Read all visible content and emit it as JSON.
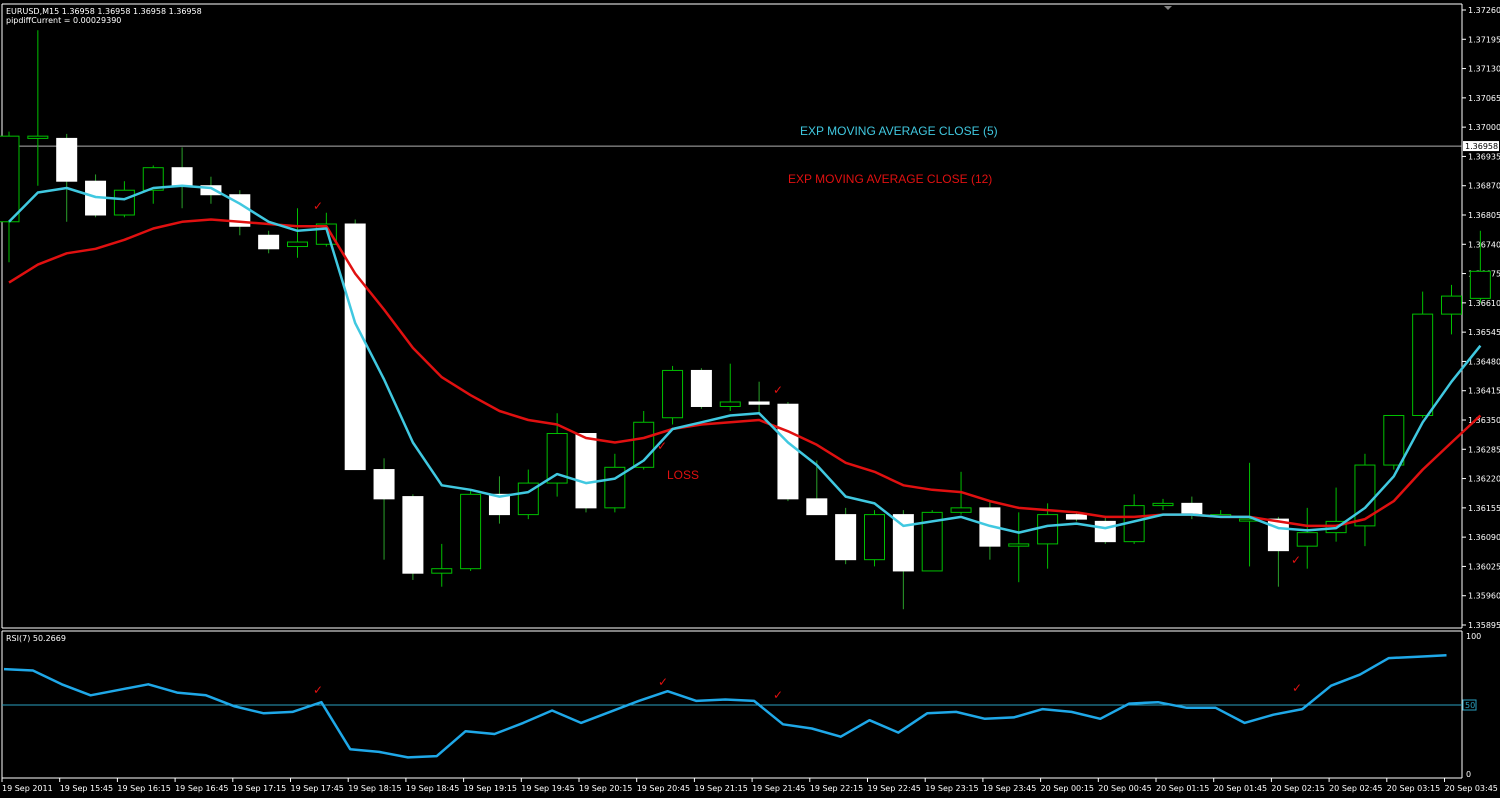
{
  "header": {
    "symbol_line": "EURUSD,M15  1.36958 1.36958 1.36958 1.36958",
    "indicator_line": "pipdiffCurrent = 0.00029390"
  },
  "annotations": {
    "ema5_label": "EXP MOVING AVERAGE CLOSE (5)",
    "ema12_label": "EXP MOVING AVERAGE CLOSE (12)",
    "loss_label": "LOSS",
    "checkmark": "✓"
  },
  "rsi_panel": {
    "title": "RSI(7) 50.2669",
    "level_label": "50",
    "tick_top": "100",
    "tick_bottom": "0"
  },
  "colors": {
    "background": "#000000",
    "grid": "#ffffff",
    "bull_candle": "#00c000",
    "bear_candle": "#ffffff",
    "ema5": "#40c8e0",
    "ema12": "#e01010",
    "annotation_red": "#e01010",
    "annotation_cyan": "#40c8e0",
    "rsi_line": "#1fa8e8",
    "rsi_level": "#2aa0c0"
  },
  "chart_data": {
    "type": "candlestick",
    "price_range": [
      1.35895,
      1.3726
    ],
    "current_price": 1.36958,
    "current_price_label": "1.36958",
    "price_ticks": [
      "1.37260",
      "1.37195",
      "1.37130",
      "1.37065",
      "1.37000",
      "1.36935",
      "1.36870",
      "1.36805",
      "1.36740",
      "1.36675",
      "1.36610",
      "1.36545",
      "1.36480",
      "1.36415",
      "1.36350",
      "1.36285",
      "1.36220",
      "1.36155",
      "1.36090",
      "1.36025",
      "1.35960",
      "1.35895"
    ],
    "time_ticks": [
      "19 Sep 2011",
      "19 Sep 15:45",
      "19 Sep 16:15",
      "19 Sep 16:45",
      "19 Sep 17:15",
      "19 Sep 17:45",
      "19 Sep 18:15",
      "19 Sep 18:45",
      "19 Sep 19:15",
      "19 Sep 19:45",
      "19 Sep 20:15",
      "19 Sep 20:45",
      "19 Sep 21:15",
      "19 Sep 21:45",
      "19 Sep 22:15",
      "19 Sep 22:45",
      "19 Sep 23:15",
      "19 Sep 23:45",
      "20 Sep 00:15",
      "20 Sep 00:45",
      "20 Sep 01:15",
      "20 Sep 01:45",
      "20 Sep 02:15",
      "20 Sep 02:45",
      "20 Sep 03:15",
      "20 Sep 03:45"
    ],
    "candles": [
      {
        "o": 1.3679,
        "h": 1.3699,
        "l": 1.367,
        "c": 1.3698
      },
      {
        "o": 1.36975,
        "h": 1.37215,
        "l": 1.3687,
        "c": 1.3698
      },
      {
        "o": 1.36975,
        "h": 1.36985,
        "l": 1.3679,
        "c": 1.3688
      },
      {
        "o": 1.3688,
        "h": 1.36895,
        "l": 1.368,
        "c": 1.36805
      },
      {
        "o": 1.36805,
        "h": 1.3688,
        "l": 1.368,
        "c": 1.3686
      },
      {
        "o": 1.3686,
        "h": 1.36915,
        "l": 1.3683,
        "c": 1.3691
      },
      {
        "o": 1.3691,
        "h": 1.36955,
        "l": 1.3682,
        "c": 1.3687
      },
      {
        "o": 1.3687,
        "h": 1.3689,
        "l": 1.3683,
        "c": 1.3685
      },
      {
        "o": 1.3685,
        "h": 1.3686,
        "l": 1.3676,
        "c": 1.3678
      },
      {
        "o": 1.3676,
        "h": 1.3677,
        "l": 1.3672,
        "c": 1.3673
      },
      {
        "o": 1.36735,
        "h": 1.3682,
        "l": 1.3671,
        "c": 1.36745
      },
      {
        "o": 1.3674,
        "h": 1.3681,
        "l": 1.36735,
        "c": 1.36785
      },
      {
        "o": 1.36785,
        "h": 1.36795,
        "l": 1.363,
        "c": 1.3624
      },
      {
        "o": 1.3624,
        "h": 1.36265,
        "l": 1.3604,
        "c": 1.36175
      },
      {
        "o": 1.3618,
        "h": 1.36185,
        "l": 1.35995,
        "c": 1.3601
      },
      {
        "o": 1.3601,
        "h": 1.36075,
        "l": 1.3598,
        "c": 1.3602
      },
      {
        "o": 1.3602,
        "h": 1.36195,
        "l": 1.36015,
        "c": 1.36185
      },
      {
        "o": 1.36185,
        "h": 1.36225,
        "l": 1.3612,
        "c": 1.3614
      },
      {
        "o": 1.3614,
        "h": 1.3624,
        "l": 1.3613,
        "c": 1.3621
      },
      {
        "o": 1.3621,
        "h": 1.36365,
        "l": 1.3618,
        "c": 1.3632
      },
      {
        "o": 1.3632,
        "h": 1.36315,
        "l": 1.36145,
        "c": 1.36155
      },
      {
        "o": 1.36155,
        "h": 1.36275,
        "l": 1.36145,
        "c": 1.36245
      },
      {
        "o": 1.36245,
        "h": 1.3637,
        "l": 1.3624,
        "c": 1.36345
      },
      {
        "o": 1.36355,
        "h": 1.3647,
        "l": 1.3634,
        "c": 1.3646
      },
      {
        "o": 1.3646,
        "h": 1.36465,
        "l": 1.36375,
        "c": 1.3638
      },
      {
        "o": 1.3638,
        "h": 1.36475,
        "l": 1.3637,
        "c": 1.3639
      },
      {
        "o": 1.3639,
        "h": 1.36435,
        "l": 1.36365,
        "c": 1.36385
      },
      {
        "o": 1.36385,
        "h": 1.3639,
        "l": 1.3617,
        "c": 1.36175
      },
      {
        "o": 1.36175,
        "h": 1.3626,
        "l": 1.3614,
        "c": 1.3614
      },
      {
        "o": 1.3614,
        "h": 1.36155,
        "l": 1.3603,
        "c": 1.3604
      },
      {
        "o": 1.3604,
        "h": 1.3615,
        "l": 1.36025,
        "c": 1.3614
      },
      {
        "o": 1.3614,
        "h": 1.3615,
        "l": 1.3593,
        "c": 1.36015
      },
      {
        "o": 1.36015,
        "h": 1.3615,
        "l": 1.36015,
        "c": 1.36145
      },
      {
        "o": 1.36145,
        "h": 1.36235,
        "l": 1.3614,
        "c": 1.36155
      },
      {
        "o": 1.36155,
        "h": 1.3617,
        "l": 1.3604,
        "c": 1.3607
      },
      {
        "o": 1.3607,
        "h": 1.36145,
        "l": 1.3599,
        "c": 1.36075
      },
      {
        "o": 1.36075,
        "h": 1.36165,
        "l": 1.3602,
        "c": 1.3614
      },
      {
        "o": 1.3614,
        "h": 1.36145,
        "l": 1.36125,
        "c": 1.3613
      },
      {
        "o": 1.36125,
        "h": 1.36135,
        "l": 1.36075,
        "c": 1.3608
      },
      {
        "o": 1.3608,
        "h": 1.36185,
        "l": 1.36075,
        "c": 1.3616
      },
      {
        "o": 1.3616,
        "h": 1.36175,
        "l": 1.3615,
        "c": 1.36165
      },
      {
        "o": 1.36165,
        "h": 1.3618,
        "l": 1.3613,
        "c": 1.3614
      },
      {
        "o": 1.3614,
        "h": 1.3615,
        "l": 1.36135,
        "c": 1.3614
      },
      {
        "o": 1.3613,
        "h": 1.36255,
        "l": 1.36025,
        "c": 1.3613
      },
      {
        "o": 1.3613,
        "h": 1.36135,
        "l": 1.3598,
        "c": 1.3606
      },
      {
        "o": 1.3607,
        "h": 1.36155,
        "l": 1.3602,
        "c": 1.361
      },
      {
        "o": 1.361,
        "h": 1.362,
        "l": 1.3608,
        "c": 1.36125
      },
      {
        "o": 1.36115,
        "h": 1.36275,
        "l": 1.3607,
        "c": 1.3625
      },
      {
        "o": 1.3625,
        "h": 1.3635,
        "l": 1.3624,
        "c": 1.3636
      },
      {
        "o": 1.3636,
        "h": 1.36635,
        "l": 1.36355,
        "c": 1.36585
      },
      {
        "o": 1.36585,
        "h": 1.3665,
        "l": 1.3654,
        "c": 1.36625
      },
      {
        "o": 1.3662,
        "h": 1.3677,
        "l": 1.3661,
        "c": 1.3668
      }
    ],
    "ema5": [
      1.3679,
      1.36855,
      1.36865,
      1.36845,
      1.3684,
      1.36865,
      1.3687,
      1.36865,
      1.3683,
      1.3679,
      1.3677,
      1.36775,
      1.36565,
      1.3644,
      1.363,
      1.36205,
      1.36195,
      1.3618,
      1.3619,
      1.3623,
      1.3621,
      1.3622,
      1.3626,
      1.3633,
      1.36345,
      1.3636,
      1.36365,
      1.363,
      1.3625,
      1.3618,
      1.36165,
      1.36115,
      1.36125,
      1.36135,
      1.36115,
      1.361,
      1.36115,
      1.3612,
      1.3611,
      1.36125,
      1.3614,
      1.3614,
      1.36135,
      1.36135,
      1.3611,
      1.36105,
      1.3611,
      1.36155,
      1.36225,
      1.36345,
      1.36435,
      1.36515
    ],
    "ema12": [
      1.36655,
      1.36695,
      1.3672,
      1.3673,
      1.3675,
      1.36775,
      1.3679,
      1.36795,
      1.3679,
      1.36785,
      1.3678,
      1.3678,
      1.36675,
      1.36595,
      1.3651,
      1.36445,
      1.36405,
      1.3637,
      1.3635,
      1.3634,
      1.3631,
      1.363,
      1.3631,
      1.3633,
      1.3634,
      1.36345,
      1.3635,
      1.36325,
      1.36295,
      1.36255,
      1.36235,
      1.36205,
      1.36195,
      1.3619,
      1.3617,
      1.36155,
      1.3615,
      1.36145,
      1.36135,
      1.36135,
      1.3614,
      1.3614,
      1.36135,
      1.36135,
      1.36125,
      1.36115,
      1.36115,
      1.3613,
      1.3617,
      1.3624,
      1.363,
      1.3636
    ],
    "rsi": [
      76,
      75,
      65,
      57,
      61,
      65,
      59,
      57,
      49,
      44,
      45,
      52,
      18,
      16,
      12,
      13,
      31,
      29,
      37,
      46,
      37,
      45,
      53,
      60,
      53,
      54,
      53,
      36,
      33,
      27,
      39,
      30,
      44,
      45,
      40,
      41,
      47,
      45,
      40,
      51,
      52,
      48,
      48,
      37,
      43,
      47,
      64,
      72,
      84,
      85,
      86
    ],
    "rsi_level": 50,
    "rsi_range": [
      0,
      100
    ]
  }
}
